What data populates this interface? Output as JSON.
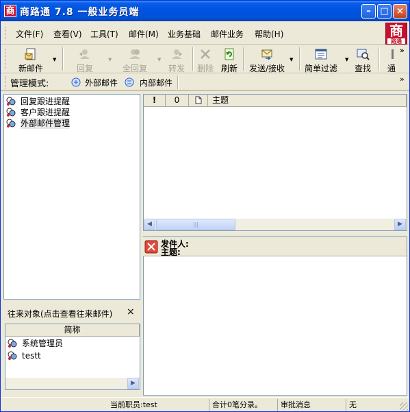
{
  "window": {
    "title": "商路通 7.8 一般业务员端",
    "app_icon_glyph": "商",
    "minimize_glyph": "–",
    "maximize_glyph": "□",
    "close_glyph": "×"
  },
  "menu": {
    "items": [
      "文件(F)",
      "查看(V)",
      "工具(T)",
      "邮件(M)",
      "业务基础",
      "邮件业务",
      "帮助(H)"
    ],
    "overflow": "»"
  },
  "brand": {
    "logo_glyph": "商",
    "logo_sub": "路通"
  },
  "toolbar": {
    "new_mail": "新邮件",
    "reply": "回复",
    "reply_all": "全回复",
    "forward": "转发",
    "delete": "删除",
    "refresh": "刷新",
    "send_receive": "发送/接收",
    "list_filter": "简单过滤",
    "find": "查找",
    "more": "通",
    "overflow": "»"
  },
  "modebar": {
    "label": "管理模式:",
    "external": "外部邮件",
    "internal": "内部邮件",
    "overflow": "»"
  },
  "tree": {
    "items": [
      "回复跟进提醒",
      "客户跟进提醒",
      "外部邮件管理"
    ]
  },
  "mail_list": {
    "columns": [
      "!",
      "0",
      "",
      "主题"
    ]
  },
  "preview": {
    "sender_label": "发件人:",
    "subject_label": "主题:"
  },
  "contacts": {
    "title": "往来对象(点击查看往来邮件)",
    "close_glyph": "×",
    "column": "简称",
    "items": [
      "系统管理员",
      "testt"
    ]
  },
  "statusbar": {
    "current_user": "当前职员:test",
    "total": "合计0笔分录。",
    "approval": "审批消息",
    "none": "无"
  },
  "colors": {
    "titlebar": "#0054e3",
    "accent_red": "#c8102e",
    "window_bg": "#ece9d8"
  }
}
